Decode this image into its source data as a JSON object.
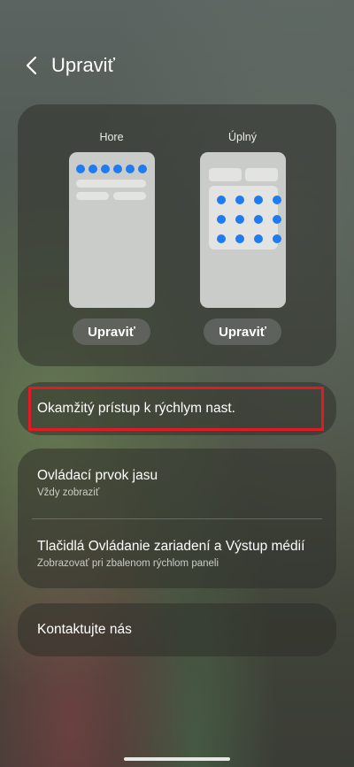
{
  "header": {
    "title": "Upraviť"
  },
  "layout": {
    "top_option": {
      "label": "Hore",
      "edit_label": "Upraviť"
    },
    "full_option": {
      "label": "Úplný",
      "edit_label": "Upraviť"
    }
  },
  "quick_access": {
    "label": "Okamžitý prístup k rýchlym nast."
  },
  "settings": [
    {
      "title": "Ovládací prvok jasu",
      "subtitle": "Vždy zobraziť"
    },
    {
      "title": "Tlačidlá Ovládanie zariadení a Výstup médií",
      "subtitle": "Zobrazovať pri zbalenom rýchlom paneli"
    }
  ],
  "contact": {
    "label": "Kontaktujte nás"
  },
  "colors": {
    "accent": "#1e7cf0",
    "highlight": "#e01b24"
  },
  "icons": {
    "back": "chevron-left-icon"
  }
}
